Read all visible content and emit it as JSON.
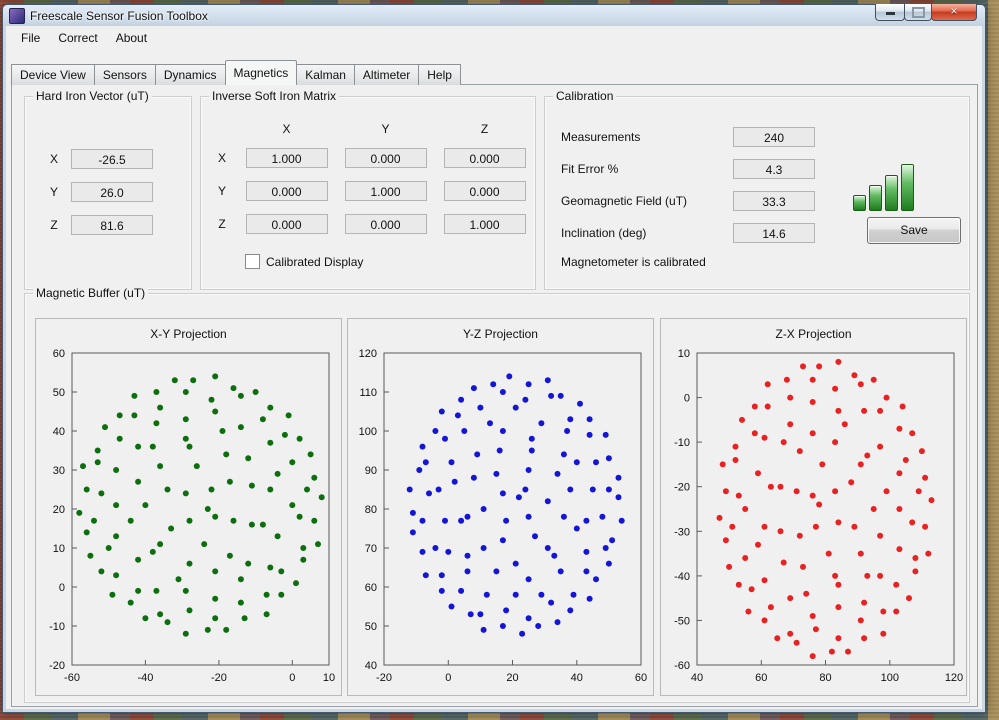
{
  "window": {
    "title": "Freescale Sensor Fusion Toolbox"
  },
  "icons": {
    "close": "×"
  },
  "menu": {
    "items": [
      "File",
      "Correct",
      "About"
    ]
  },
  "tabs": {
    "active_index": 3,
    "items": [
      {
        "label": "Device View"
      },
      {
        "label": "Sensors"
      },
      {
        "label": "Dynamics"
      },
      {
        "label": "Magnetics"
      },
      {
        "label": "Kalman"
      },
      {
        "label": "Altimeter"
      },
      {
        "label": "Help"
      }
    ]
  },
  "hard_iron": {
    "title": "Hard Iron Vector (uT)",
    "rows": [
      {
        "label": "X",
        "value": "-26.5"
      },
      {
        "label": "Y",
        "value": "26.0"
      },
      {
        "label": "Z",
        "value": "81.6"
      }
    ]
  },
  "soft_iron": {
    "title": "Inverse Soft Iron Matrix",
    "col_headers": [
      "X",
      "Y",
      "Z"
    ],
    "rows": [
      {
        "label": "X",
        "values": [
          "1.000",
          "0.000",
          "0.000"
        ]
      },
      {
        "label": "Y",
        "values": [
          "0.000",
          "1.000",
          "0.000"
        ]
      },
      {
        "label": "Z",
        "values": [
          "0.000",
          "0.000",
          "1.000"
        ]
      }
    ],
    "checkbox_label": "Calibrated Display",
    "checkbox_checked": false
  },
  "calibration": {
    "title": "Calibration",
    "fields": [
      {
        "label": "Measurements",
        "value": "240"
      },
      {
        "label": "Fit Error %",
        "value": "4.3"
      },
      {
        "label": "Geomagnetic Field (uT)",
        "value": "33.3"
      },
      {
        "label": "Inclination (deg)",
        "value": "14.6"
      }
    ],
    "status": "Magnetometer is calibrated",
    "save_label": "Save"
  },
  "magnetic_buffer": {
    "title": "Magnetic Buffer (uT)"
  },
  "chart_data": [
    {
      "type": "scatter",
      "title": "X-Y Projection",
      "color": "#0d6e0d",
      "xlim": [
        -60,
        10
      ],
      "ylim": [
        -20,
        60
      ],
      "xticks": [
        -60,
        -40,
        -20,
        0,
        10
      ],
      "yticks": [
        -20,
        -10,
        0,
        10,
        20,
        30,
        40,
        50,
        60
      ],
      "points": [
        [
          8,
          23
        ],
        [
          6,
          28
        ],
        [
          5,
          34
        ],
        [
          2,
          38
        ],
        [
          -1,
          44
        ],
        [
          -6,
          46
        ],
        [
          -10,
          50
        ],
        [
          -16,
          51
        ],
        [
          -21,
          54
        ],
        [
          -27,
          53
        ],
        [
          -32,
          53
        ],
        [
          -37,
          50
        ],
        [
          -43,
          49
        ],
        [
          -47,
          44
        ],
        [
          -51,
          41
        ],
        [
          -53,
          35
        ],
        [
          -57,
          31
        ],
        [
          -56,
          25
        ],
        [
          -58,
          19
        ],
        [
          -56,
          14
        ],
        [
          -55,
          8
        ],
        [
          -52,
          4
        ],
        [
          -49,
          -2
        ],
        [
          -44,
          -4
        ],
        [
          -40,
          -8
        ],
        [
          -34,
          -9
        ],
        [
          -29,
          -12
        ],
        [
          -23,
          -11
        ],
        [
          -18,
          -11
        ],
        [
          -13,
          -8
        ],
        [
          -7,
          -7
        ],
        [
          -3,
          -2
        ],
        [
          1,
          1
        ],
        [
          3,
          7
        ],
        [
          7,
          11
        ],
        [
          6,
          17
        ],
        [
          4,
          25
        ],
        [
          0,
          32
        ],
        [
          -2,
          39
        ],
        [
          -8,
          43
        ],
        [
          -14,
          49
        ],
        [
          -22,
          48
        ],
        [
          -29,
          50
        ],
        [
          -36,
          46
        ],
        [
          -43,
          44
        ],
        [
          -47,
          38
        ],
        [
          -53,
          32
        ],
        [
          -52,
          24
        ],
        [
          -54,
          17
        ],
        [
          -50,
          10
        ],
        [
          -48,
          3
        ],
        [
          -42,
          -1
        ],
        [
          -36,
          -7
        ],
        [
          -28,
          -6
        ],
        [
          -21,
          -8
        ],
        [
          -14,
          -4
        ],
        [
          -7,
          -2
        ],
        [
          -3,
          4
        ],
        [
          3,
          10
        ],
        [
          2,
          18
        ],
        [
          0,
          21
        ],
        [
          -4,
          29
        ],
        [
          -6,
          37
        ],
        [
          -14,
          41
        ],
        [
          -21,
          45
        ],
        [
          -29,
          43
        ],
        [
          -37,
          42
        ],
        [
          -42,
          36
        ],
        [
          -48,
          30
        ],
        [
          -48,
          21
        ],
        [
          -48,
          13
        ],
        [
          -42,
          7
        ],
        [
          -37,
          -1
        ],
        [
          -29,
          -1
        ],
        [
          -21,
          -3
        ],
        [
          -14,
          2
        ],
        [
          -6,
          5
        ],
        [
          -4,
          13
        ],
        [
          -6,
          25
        ],
        [
          -12,
          33
        ],
        [
          -19,
          40
        ],
        [
          -29,
          38
        ],
        [
          -38,
          36
        ],
        [
          -42,
          27
        ],
        [
          -44,
          17
        ],
        [
          -38,
          9
        ],
        [
          -31,
          2
        ],
        [
          -21,
          4
        ],
        [
          -12,
          6
        ],
        [
          -8,
          16
        ],
        [
          -11,
          26
        ],
        [
          -18,
          34
        ],
        [
          -28,
          36
        ],
        [
          -36,
          31
        ],
        [
          -40,
          21
        ],
        [
          -36,
          11
        ],
        [
          -28,
          6
        ],
        [
          -17,
          8
        ],
        [
          -11,
          16
        ],
        [
          -17,
          27
        ],
        [
          -26,
          31
        ],
        [
          -34,
          25
        ],
        [
          -33,
          15
        ],
        [
          -24,
          11
        ],
        [
          -16,
          17
        ],
        [
          -22,
          25
        ],
        [
          -29,
          24
        ],
        [
          -28,
          17
        ],
        [
          -21,
          18
        ],
        [
          -23,
          20
        ]
      ]
    },
    {
      "type": "scatter",
      "title": "Y-Z Projection",
      "color": "#1515d6",
      "xlim": [
        -20,
        60
      ],
      "ylim": [
        40,
        120
      ],
      "xticks": [
        -20,
        0,
        20,
        40,
        60
      ],
      "yticks": [
        40,
        50,
        60,
        70,
        80,
        90,
        100,
        110,
        120
      ],
      "points": [
        [
          19,
          114
        ],
        [
          14,
          112
        ],
        [
          8,
          111
        ],
        [
          4,
          108
        ],
        [
          -2,
          105
        ],
        [
          -4,
          100
        ],
        [
          -8,
          96
        ],
        [
          -9,
          90
        ],
        [
          -12,
          85
        ],
        [
          -11,
          79
        ],
        [
          -11,
          74
        ],
        [
          -8,
          69
        ],
        [
          -7,
          63
        ],
        [
          -2,
          59
        ],
        [
          1,
          55
        ],
        [
          7,
          53
        ],
        [
          11,
          49
        ],
        [
          17,
          50
        ],
        [
          23,
          48
        ],
        [
          28,
          50
        ],
        [
          34,
          51
        ],
        [
          38,
          54
        ],
        [
          44,
          57
        ],
        [
          46,
          62
        ],
        [
          50,
          66
        ],
        [
          51,
          72
        ],
        [
          54,
          77
        ],
        [
          53,
          83
        ],
        [
          53,
          88
        ],
        [
          50,
          93
        ],
        [
          49,
          99
        ],
        [
          44,
          103
        ],
        [
          41,
          107
        ],
        [
          35,
          109
        ],
        [
          31,
          113
        ],
        [
          25,
          112
        ],
        [
          17,
          110
        ],
        [
          10,
          106
        ],
        [
          3,
          104
        ],
        [
          -1,
          98
        ],
        [
          -7,
          92
        ],
        [
          -6,
          84
        ],
        [
          -8,
          77
        ],
        [
          -4,
          70
        ],
        [
          -2,
          63
        ],
        [
          4,
          59
        ],
        [
          10,
          53
        ],
        [
          18,
          54
        ],
        [
          25,
          52
        ],
        [
          32,
          56
        ],
        [
          39,
          58
        ],
        [
          43,
          64
        ],
        [
          49,
          70
        ],
        [
          48,
          78
        ],
        [
          50,
          85
        ],
        [
          46,
          92
        ],
        [
          44,
          99
        ],
        [
          38,
          103
        ],
        [
          32,
          109
        ],
        [
          24,
          108
        ],
        [
          21,
          106
        ],
        [
          13,
          102
        ],
        [
          5,
          100
        ],
        [
          1,
          92
        ],
        [
          -3,
          85
        ],
        [
          -1,
          77
        ],
        [
          0,
          69
        ],
        [
          6,
          64
        ],
        [
          12,
          58
        ],
        [
          21,
          58
        ],
        [
          29,
          58
        ],
        [
          35,
          64
        ],
        [
          43,
          69
        ],
        [
          43,
          77
        ],
        [
          45,
          85
        ],
        [
          40,
          92
        ],
        [
          37,
          100
        ],
        [
          29,
          102
        ],
        [
          17,
          100
        ],
        [
          9,
          94
        ],
        [
          2,
          87
        ],
        [
          4,
          77
        ],
        [
          6,
          68
        ],
        [
          15,
          64
        ],
        [
          25,
          62
        ],
        [
          33,
          68
        ],
        [
          40,
          75
        ],
        [
          38,
          85
        ],
        [
          36,
          94
        ],
        [
          26,
          98
        ],
        [
          16,
          95
        ],
        [
          8,
          88
        ],
        [
          6,
          78
        ],
        [
          11,
          70
        ],
        [
          21,
          66
        ],
        [
          31,
          70
        ],
        [
          36,
          78
        ],
        [
          34,
          89
        ],
        [
          26,
          95
        ],
        [
          15,
          89
        ],
        [
          11,
          80
        ],
        [
          17,
          72
        ],
        [
          27,
          73
        ],
        [
          31,
          82
        ],
        [
          25,
          90
        ],
        [
          17,
          84
        ],
        [
          18,
          77
        ],
        [
          25,
          78
        ],
        [
          24,
          85
        ],
        [
          22,
          83
        ]
      ]
    },
    {
      "type": "scatter",
      "title": "Z-X Projection",
      "color": "#e82222",
      "xlim": [
        40,
        120
      ],
      "ylim": [
        -60,
        10
      ],
      "xticks": [
        40,
        60,
        80,
        100,
        120
      ],
      "yticks": [
        -60,
        -50,
        -40,
        -30,
        -20,
        -10,
        0,
        10
      ],
      "points": [
        [
          47,
          -27
        ],
        [
          49,
          -32
        ],
        [
          50,
          -38
        ],
        [
          53,
          -42
        ],
        [
          56,
          -48
        ],
        [
          61,
          -50
        ],
        [
          65,
          -54
        ],
        [
          71,
          -55
        ],
        [
          76,
          -58
        ],
        [
          82,
          -57
        ],
        [
          87,
          -57
        ],
        [
          92,
          -54
        ],
        [
          98,
          -53
        ],
        [
          102,
          -48
        ],
        [
          106,
          -45
        ],
        [
          108,
          -39
        ],
        [
          112,
          -35
        ],
        [
          111,
          -29
        ],
        [
          113,
          -23
        ],
        [
          111,
          -18
        ],
        [
          110,
          -12
        ],
        [
          107,
          -8
        ],
        [
          104,
          -2
        ],
        [
          99,
          0
        ],
        [
          95,
          4
        ],
        [
          89,
          5
        ],
        [
          84,
          8
        ],
        [
          78,
          7
        ],
        [
          73,
          7
        ],
        [
          68,
          4
        ],
        [
          62,
          3
        ],
        [
          58,
          -2
        ],
        [
          54,
          -5
        ],
        [
          52,
          -11
        ],
        [
          48,
          -15
        ],
        [
          49,
          -21
        ],
        [
          51,
          -29
        ],
        [
          55,
          -36
        ],
        [
          57,
          -43
        ],
        [
          63,
          -47
        ],
        [
          69,
          -53
        ],
        [
          77,
          -52
        ],
        [
          84,
          -54
        ],
        [
          91,
          -50
        ],
        [
          98,
          -48
        ],
        [
          102,
          -42
        ],
        [
          108,
          -36
        ],
        [
          107,
          -28
        ],
        [
          109,
          -21
        ],
        [
          105,
          -14
        ],
        [
          103,
          -7
        ],
        [
          97,
          -3
        ],
        [
          91,
          3
        ],
        [
          83,
          2
        ],
        [
          76,
          4
        ],
        [
          69,
          0
        ],
        [
          62,
          -2
        ],
        [
          58,
          -8
        ],
        [
          52,
          -14
        ],
        [
          53,
          -22
        ],
        [
          55,
          -25
        ],
        [
          59,
          -33
        ],
        [
          61,
          -41
        ],
        [
          69,
          -45
        ],
        [
          76,
          -49
        ],
        [
          84,
          -47
        ],
        [
          92,
          -46
        ],
        [
          97,
          -40
        ],
        [
          103,
          -34
        ],
        [
          103,
          -25
        ],
        [
          103,
          -17
        ],
        [
          97,
          -11
        ],
        [
          92,
          -3
        ],
        [
          84,
          -3
        ],
        [
          76,
          -1
        ],
        [
          69,
          -6
        ],
        [
          61,
          -9
        ],
        [
          59,
          -17
        ],
        [
          61,
          -29
        ],
        [
          67,
          -37
        ],
        [
          74,
          -44
        ],
        [
          84,
          -42
        ],
        [
          93,
          -40
        ],
        [
          97,
          -31
        ],
        [
          99,
          -21
        ],
        [
          93,
          -13
        ],
        [
          86,
          -6
        ],
        [
          76,
          -8
        ],
        [
          67,
          -10
        ],
        [
          63,
          -20
        ],
        [
          66,
          -30
        ],
        [
          73,
          -38
        ],
        [
          83,
          -40
        ],
        [
          91,
          -35
        ],
        [
          95,
          -25
        ],
        [
          91,
          -15
        ],
        [
          83,
          -10
        ],
        [
          72,
          -12
        ],
        [
          66,
          -20
        ],
        [
          72,
          -31
        ],
        [
          81,
          -35
        ],
        [
          89,
          -29
        ],
        [
          88,
          -19
        ],
        [
          79,
          -15
        ],
        [
          71,
          -21
        ],
        [
          77,
          -29
        ],
        [
          84,
          -28
        ],
        [
          83,
          -21
        ],
        [
          76,
          -22
        ],
        [
          78,
          -24
        ]
      ]
    }
  ]
}
